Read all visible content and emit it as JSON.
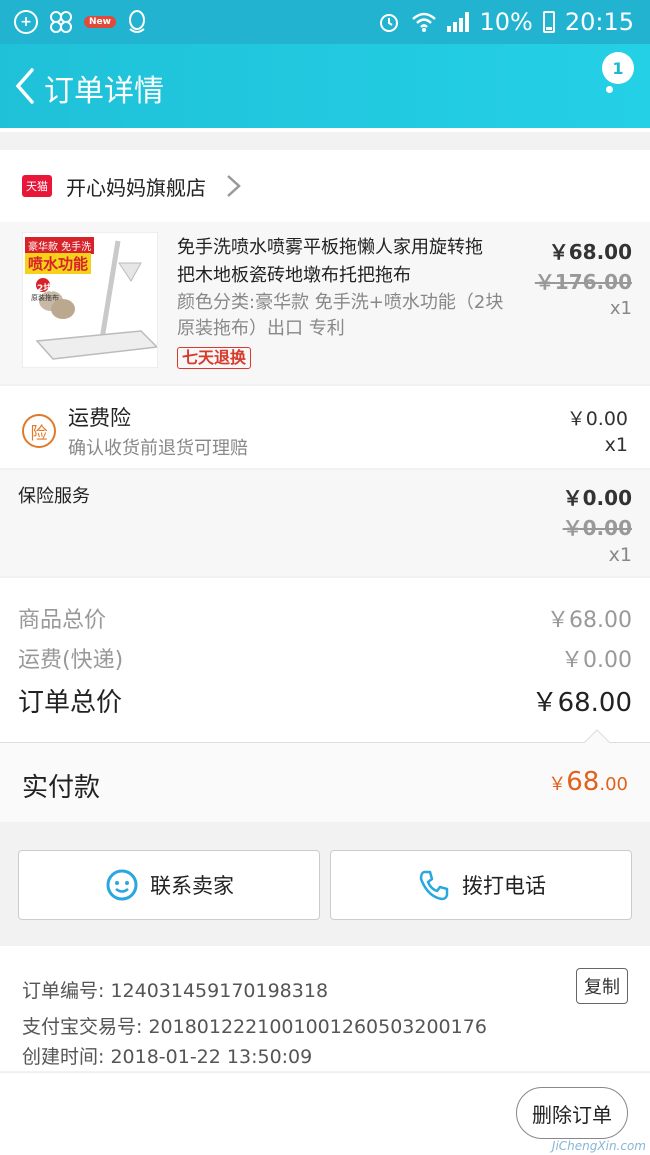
{
  "statusbar": {
    "new_badge": "New",
    "battery": "10%",
    "time": "20:15"
  },
  "nav": {
    "title": "订单详情",
    "badge_count": "1"
  },
  "shop": {
    "platform_tag": "天猫",
    "name": "开心妈妈旗舰店"
  },
  "item": {
    "title": "免手洗喷水喷雾平板拖懒人家用旋转拖把木地板瓷砖地墩布托把拖布",
    "sku": "颜色分类:豪华款 免手洗+喷水功能（2块原装拖布）出口 专利",
    "tag": "七天退换",
    "price": "￥68.00",
    "original_price": "￥176.00",
    "quantity": "x1",
    "image_text_1": "豪华款 免手洗",
    "image_text_2": "喷水功能",
    "image_text_3": "2块",
    "image_text_4": "原装拖布"
  },
  "insurance": {
    "icon_char": "险",
    "title": "运费险",
    "subtitle": "确认收货前退货可理赔",
    "price": "￥0.00",
    "quantity": "x1"
  },
  "service": {
    "title": "保险服务",
    "price": "￥0.00",
    "original_price": "￥0.00",
    "quantity": "x1"
  },
  "summary": {
    "goods_label": "商品总价",
    "goods_value": "￥68.00",
    "shipping_label": "运费(快递)",
    "shipping_value": "￥0.00",
    "total_label": "订单总价",
    "total_value": "￥68.00"
  },
  "payment": {
    "label": "实付款",
    "currency": "￥",
    "integer": "68",
    "decimal": ".00"
  },
  "actions": {
    "contact_seller": "联系卖家",
    "call": "拨打电话"
  },
  "info": {
    "order_no": "订单编号: 124031459170198318",
    "alipay_no": "支付宝交易号: 2018012221001001260503200176",
    "created": "创建时间: 2018-01-22 13:50:09",
    "copy_label": "复制"
  },
  "footer": {
    "delete_label": "删除订单",
    "watermark": "JiChengXin.com"
  },
  "colors": {
    "nav_bg": "#22b3d0",
    "accent_price": "#e0621d",
    "tmall_red": "#e8173a",
    "tag_red": "#d83a2b"
  }
}
